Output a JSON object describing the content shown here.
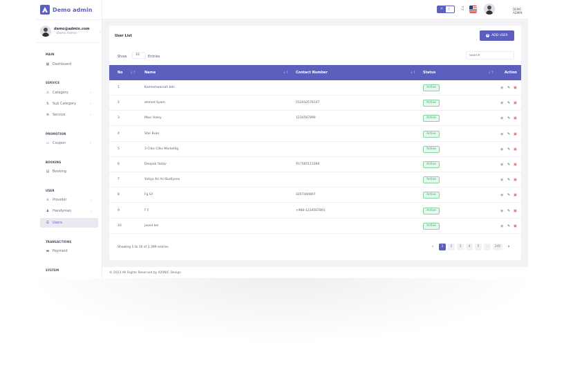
{
  "brand": {
    "name": "Demo admin"
  },
  "profile": {
    "email": "demo@admin.com",
    "role": "Demo Admin"
  },
  "topbar": {
    "user_label": "DEMO ADMIN"
  },
  "sidebar": {
    "sections": [
      {
        "title": "MAIN",
        "items": [
          {
            "label": "Dashboard",
            "icon": "dashboard-icon",
            "has_children": false,
            "active": false
          }
        ]
      },
      {
        "title": "SERVICE",
        "items": [
          {
            "label": "Category",
            "icon": "category-icon",
            "has_children": true,
            "active": false
          },
          {
            "label": "Sub Category",
            "icon": "sub-category-icon",
            "has_children": true,
            "active": false
          },
          {
            "label": "Service",
            "icon": "service-icon",
            "has_children": true,
            "active": false
          }
        ]
      },
      {
        "title": "PROMOTION",
        "items": [
          {
            "label": "Coupon",
            "icon": "coupon-icon",
            "has_children": true,
            "active": false
          }
        ]
      },
      {
        "title": "BOOKING",
        "items": [
          {
            "label": "Booking",
            "icon": "booking-icon",
            "has_children": false,
            "active": false
          }
        ]
      },
      {
        "title": "USER",
        "items": [
          {
            "label": "Provider",
            "icon": "provider-icon",
            "has_children": true,
            "active": false
          },
          {
            "label": "Handyman",
            "icon": "handyman-icon",
            "has_children": true,
            "active": false
          },
          {
            "label": "Users",
            "icon": "users-icon",
            "has_children": false,
            "active": true
          }
        ]
      },
      {
        "title": "TRANSACTIONS",
        "items": [
          {
            "label": "Payment",
            "icon": "payment-icon",
            "has_children": false,
            "active": false
          }
        ]
      },
      {
        "title": "SYSTEM",
        "items": []
      }
    ]
  },
  "card": {
    "title": "User List",
    "add_button": "ADD USER",
    "show_label": "Show",
    "page_size": "10",
    "entries_label": "Entries",
    "search_placeholder": "Search"
  },
  "table": {
    "columns": [
      "No",
      "Name",
      "Contact Number",
      "Status",
      "Action"
    ],
    "rows": [
      {
        "no": "1",
        "name": "Kameshwarsah bds",
        "contact": "",
        "status": "Active"
      },
      {
        "no": "2",
        "name": "ahmed Syam",
        "contact": "012032576147",
        "status": "Active"
      },
      {
        "no": "3",
        "name": "Maci Haley",
        "contact": "1234567890",
        "status": "Active"
      },
      {
        "no": "4",
        "name": "Star Buks",
        "contact": "",
        "status": "Active"
      },
      {
        "no": "5",
        "name": "3 Cliks Cliks Marketlig",
        "contact": "",
        "status": "Active"
      },
      {
        "no": "6",
        "name": "Deepak Yadav",
        "contact": "917565113366",
        "status": "Active"
      },
      {
        "no": "7",
        "name": "Yutiya Ari Ari Budiyono",
        "contact": "",
        "status": "Active"
      },
      {
        "no": "8",
        "name": "Fg Gf",
        "contact": "0207460807",
        "status": "Active"
      },
      {
        "no": "9",
        "name": "F F",
        "contact": "+966-1234567891",
        "status": "Active"
      },
      {
        "no": "10",
        "name": "javed ker",
        "contact": "",
        "status": "Active"
      }
    ]
  },
  "pagination": {
    "info": "Showing 1 to 10 of 2,399 entries",
    "pages": [
      "1",
      "2",
      "3",
      "4",
      "5",
      "...",
      "240"
    ],
    "current": "1"
  },
  "footer": {
    "text": "© 2023 All Rights Reserved by IQONIC Design"
  },
  "colors": {
    "primary": "#5d5fbf",
    "active_badge": "#38a866",
    "delete": "#e15a5a"
  }
}
